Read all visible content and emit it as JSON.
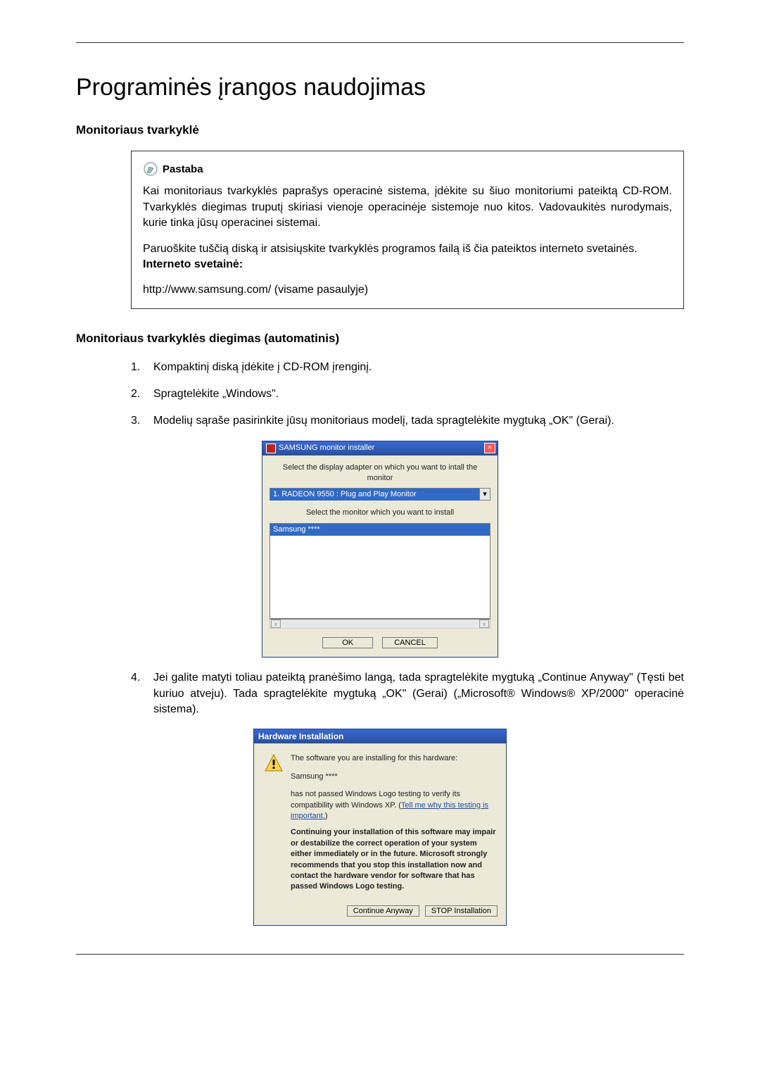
{
  "title": "Programinės įrangos naudojimas",
  "section1_heading": "Monitoriaus tvarkyklė",
  "note": {
    "label": "Pastaba",
    "p1": "Kai monitoriaus tvarkyklės paprašys operacinė sistema, įdėkite su šiuo monitoriumi pateiktą CD-ROM. Tvarkyklės diegimas truputį skiriasi vienoje operacinėje sistemoje nuo kitos. Vadovaukitės nurodymais, kurie tinka jūsų operacinei sistemai.",
    "p2": "Paruoškite tuščią diską ir atsisiųskite tvarkyklės programos failą iš čia pateiktos interneto svetainės.",
    "website_label": "Interneto svetainė:",
    "website_url": "http://www.samsung.com/ (visame pasaulyje)"
  },
  "section2_heading": "Monitoriaus tvarkyklės diegimas (automatinis)",
  "steps": {
    "s1": "Kompaktinį diską įdėkite į CD-ROM įrenginį.",
    "s2": "Spragtelėkite „Windows\".",
    "s3": "Modelių sąraše pasirinkite jūsų monitoriaus modelį, tada spragtelėkite mygtuką „OK\" (Gerai).",
    "s4": "Jei galite matyti toliau pateiktą pranėšimo langą, tada spragtelėkite mygtuką „Continue Anyway\" (Tęsti bet kuriuo atveju). Tada spragtelėkite mygtuką „OK\" (Gerai) („Microsoft® Windows® XP/2000\" operacinė sistema)."
  },
  "installer": {
    "title": "SAMSUNG monitor installer",
    "prompt1": "Select the display adapter on which you want to intall the monitor",
    "select_value": "1. RADEON 9550 : Plug and Play Monitor",
    "prompt2": "Select the monitor which you want to install",
    "list_item": "Samsung ****",
    "ok": "OK",
    "cancel": "CANCEL"
  },
  "hw": {
    "title": "Hardware Installation",
    "line1": "The software you are installing for this hardware:",
    "name": "Samsung ****",
    "compat": "has not passed Windows Logo testing to verify its compatibility with Windows XP. (",
    "link": "Tell me why this testing is important.",
    "close_paren": ")",
    "bold": "Continuing your installation of this software may impair or destabilize the correct operation of your system either immediately or in the future. Microsoft strongly recommends that you stop this installation now and contact the hardware vendor for software that has passed Windows Logo testing.",
    "continue": "Continue Anyway",
    "stop": "STOP Installation"
  }
}
